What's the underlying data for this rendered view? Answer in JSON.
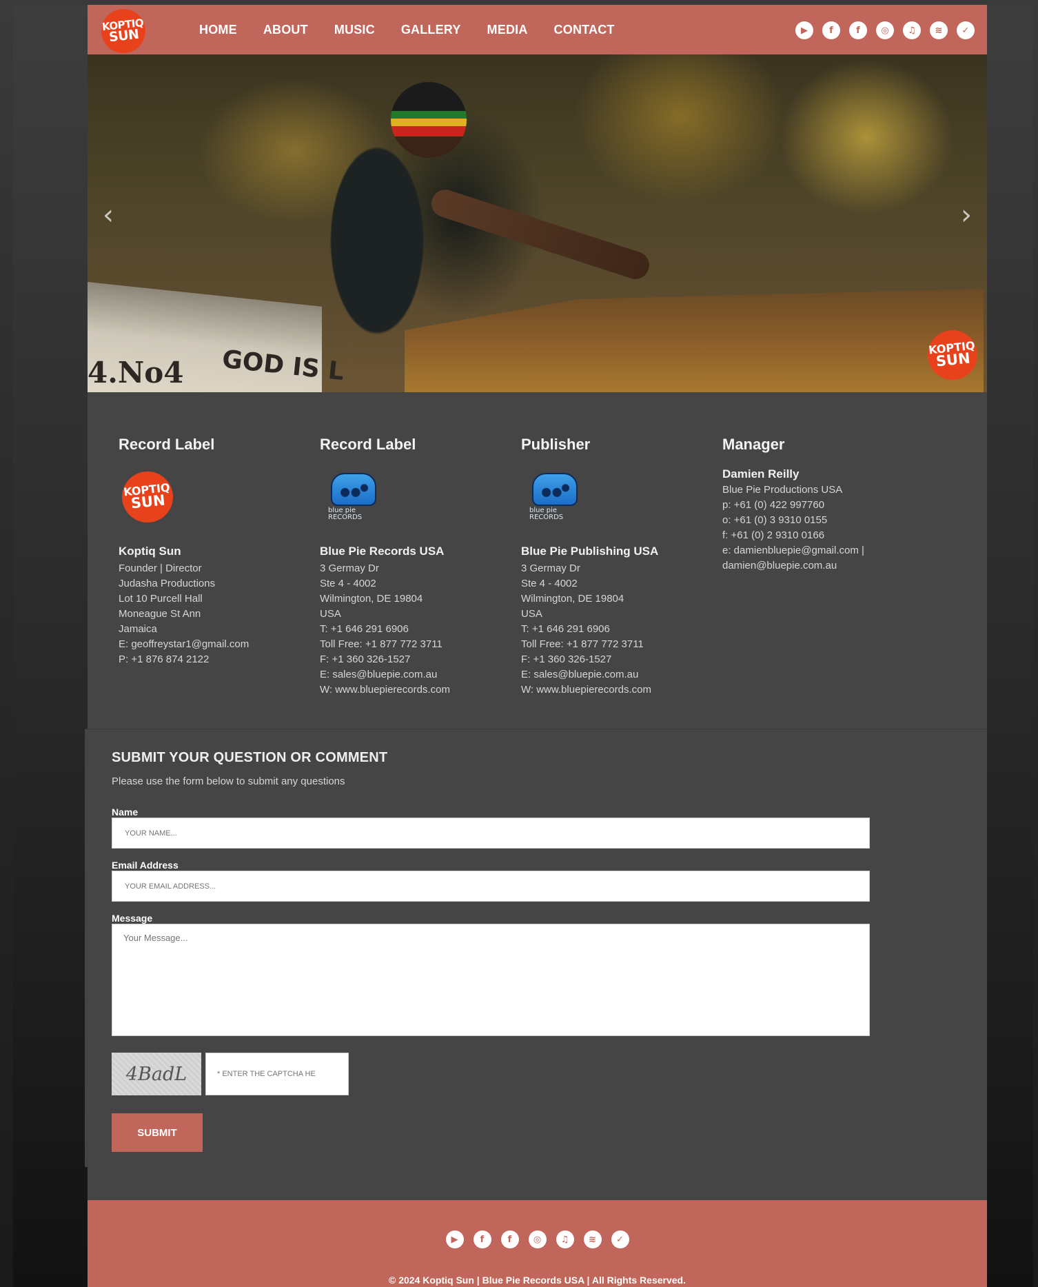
{
  "brand": {
    "logo_top": "KOPTIQ",
    "logo_bottom": "SUN"
  },
  "nav": {
    "items": [
      "HOME",
      "ABOUT",
      "MUSIC",
      "GALLERY",
      "MEDIA",
      "CONTACT"
    ]
  },
  "social_icons": [
    "youtube-icon",
    "facebook-icon",
    "facebook-icon",
    "instagram-icon",
    "music-icon",
    "spotify-icon",
    "twitter-icon"
  ],
  "hero": {
    "boat_text_left": "4.No4",
    "boat_text_right": "GOD IS L"
  },
  "contacts": [
    {
      "heading": "Record Label",
      "logo": "koptiq-sun-logo",
      "name": "Koptiq Sun",
      "lines": [
        "Founder | Director",
        "Judasha Productions",
        "Lot 10 Purcell Hall",
        "Moneague St Ann",
        "Jamaica",
        "E: geoffreystar1@gmail.com",
        "P: +1 876 874 2122"
      ]
    },
    {
      "heading": "Record Label",
      "logo": "blue-pie-logo",
      "logo_text": "blue pie RECORDS",
      "name": "Blue Pie Records USA",
      "lines": [
        "3 Germay Dr",
        "Ste 4 - 4002",
        "Wilmington, DE 19804",
        "USA",
        "T: +1 646 291 6906",
        "Toll Free: +1 877 772 3711",
        "F: +1 360 326-1527",
        "E: sales@bluepie.com.au",
        "W: www.bluepierecords.com"
      ]
    },
    {
      "heading": "Publisher",
      "logo": "blue-pie-logo",
      "logo_text": "blue pie RECORDS",
      "name": "Blue Pie Publishing USA",
      "lines": [
        "3 Germay Dr",
        "Ste 4 - 4002",
        "Wilmington, DE 19804",
        "USA",
        "T: +1 646 291 6906",
        "Toll Free: +1 877 772 3711",
        "F: +1 360 326-1527",
        "E: sales@bluepie.com.au",
        "W: www.bluepierecords.com"
      ]
    },
    {
      "heading": "Manager",
      "name": "Damien Reilly",
      "lines": [
        "Blue Pie Productions USA",
        "p: +61 (0) 422 997760",
        "o: +61 (0) 3 9310 0155",
        "f: +61 (0) 2 9310 0166",
        "e: damienbluepie@gmail.com |",
        "damien@bluepie.com.au"
      ]
    }
  ],
  "form": {
    "title": "SUBMIT YOUR QUESTION OR COMMENT",
    "subtitle": "Please use the form below to submit any questions",
    "name_label": "Name",
    "name_placeholder": "YOUR NAME...",
    "email_label": "Email Address",
    "email_placeholder": "YOUR EMAIL ADDRESS...",
    "message_label": "Message",
    "message_placeholder": "Your Message...",
    "captcha_text": "4BadL",
    "captcha_placeholder": "* ENTER THE CAPTCHA HE",
    "submit_label": "SUBMIT"
  },
  "footer": {
    "copyright": "© 2024 Koptiq Sun | Blue Pie Records USA | All Rights Reserved."
  },
  "colors": {
    "accent": "#c0665a",
    "logo": "#e8421c",
    "panel": "#454545"
  }
}
